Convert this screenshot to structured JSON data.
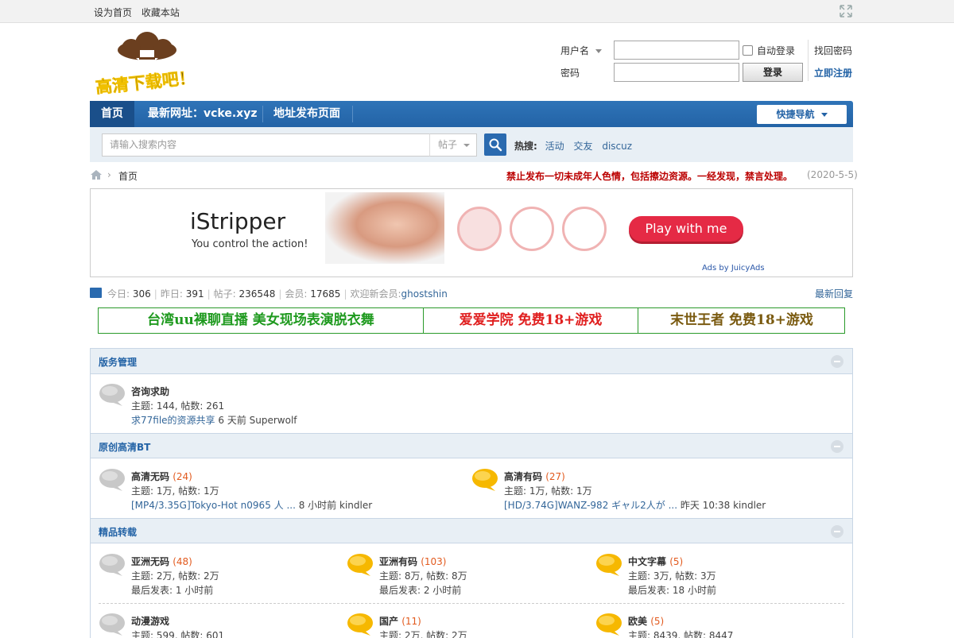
{
  "topbar": {
    "set_home": "设为首页",
    "bookmark": "收藏本站"
  },
  "logo": {
    "text": "高清下载吧！"
  },
  "login": {
    "username_label": "用户名",
    "password_label": "密码",
    "auto_login": "自动登录",
    "forgot_password": "找回密码",
    "register": "立即注册",
    "login_button": "登录"
  },
  "nav": {
    "items": [
      "首页",
      "最新网址：vcke.xyz",
      "地址发布页面"
    ],
    "quick_nav": "快捷导航"
  },
  "search": {
    "placeholder": "请输入搜索内容",
    "type": "帖子",
    "hot_label": "热搜:",
    "hot_items": [
      "活动",
      "交友",
      "discuz"
    ]
  },
  "breadcrumb": {
    "current": "首页",
    "notice": "禁止发布一切未成年人色情，包括擦边资源。一经发现，禁言处理。",
    "notice_date": "(2020-5-5)"
  },
  "ad": {
    "brand": "iStripper",
    "tagline": "You control the action!",
    "cta": "Play with me",
    "ads_by": "Ads by JuicyAds"
  },
  "stats": {
    "today_label": "今日:",
    "today": "306",
    "yesterday_label": "昨日:",
    "yesterday": "391",
    "posts_label": "帖子:",
    "posts": "236548",
    "members_label": "会员:",
    "members": "17685",
    "welcome_label": "欢迎新会员:",
    "newest_member": "ghostshin",
    "latest_replies": "最新回复"
  },
  "promo": [
    {
      "text": "台湾uu裸聊直播 美女现场表演脱衣舞",
      "color": "#1f9a1f"
    },
    {
      "text": "爱爱学院 免费18+游戏",
      "color": "#e02020"
    },
    {
      "text": "末世王者 免费18+游戏",
      "color": "#7a5a10"
    }
  ],
  "categories": [
    {
      "title": "版务管理",
      "boards": [
        {
          "name": "咨询求助",
          "count": "",
          "meta": "主题: 144, 帖数: 261",
          "last_link": "求77file的资源共享",
          "last_tail": "6 天前 Superwolf",
          "new": false
        }
      ]
    },
    {
      "title": "原创高清BT",
      "boards": [
        {
          "name": "高清无码",
          "count": "(24)",
          "meta": "主题: 1万, 帖数: 1万",
          "last_link": "[MP4/3.35G]Tokyo-Hot n0965 人 ...",
          "last_tail": "8 小时前 kindler",
          "new": false
        },
        {
          "name": "高清有码",
          "count": "(27)",
          "meta": "主题: 1万, 帖数: 1万",
          "last_link": "[HD/3.74G]WANZ-982 ギャル2人が ...",
          "last_tail": "昨天 10:38 kindler",
          "new": true
        }
      ]
    },
    {
      "title": "精品转载",
      "boards": [
        {
          "name": "亚洲无码",
          "count": "(48)",
          "meta": "主题: 2万, 帖数: 2万",
          "last": "最后发表: 1 小时前",
          "new": false
        },
        {
          "name": "亚洲有码",
          "count": "(103)",
          "meta": "主题: 8万, 帖数: 8万",
          "last": "最后发表: 2 小时前",
          "new": true
        },
        {
          "name": "中文字幕",
          "count": "(5)",
          "meta": "主题: 3万, 帖数: 3万",
          "last": "最后发表: 18 小时前",
          "new": true
        },
        {
          "name": "动漫游戏",
          "count": "",
          "meta": "主题: 599, 帖数: 601",
          "last": "",
          "new": false
        },
        {
          "name": "国产",
          "count": "(11)",
          "meta": "主题: 2万, 帖数: 2万",
          "last": "",
          "new": true
        },
        {
          "name": "欧美",
          "count": "(5)",
          "meta": "主题: 8439, 帖数: 8447",
          "last": "",
          "new": true
        }
      ]
    }
  ]
}
